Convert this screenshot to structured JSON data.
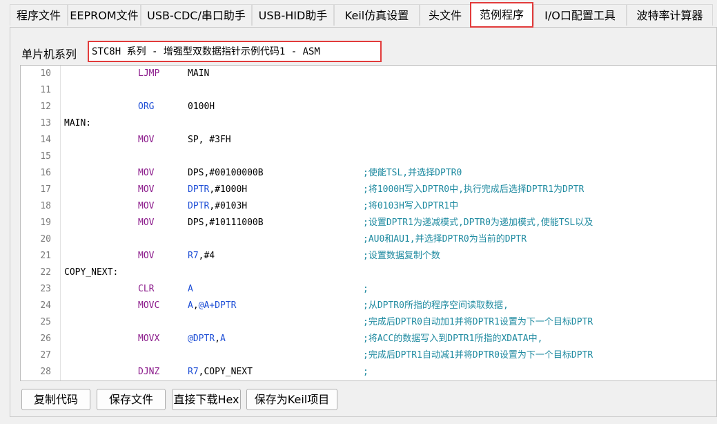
{
  "colors": {
    "highlight_border": "#e23b3b",
    "keyword_purple": "#8b1a8b",
    "register_blue": "#1f4fd6",
    "comment_teal": "#1e8aa0",
    "line_number_gray": "#7a7a7a"
  },
  "tabs": [
    {
      "label": "程序文件",
      "active": false
    },
    {
      "label": "EEPROM文件",
      "active": false
    },
    {
      "label": "USB-CDC/串口助手",
      "active": false
    },
    {
      "label": "USB-HID助手",
      "active": false
    },
    {
      "label": "Keil仿真设置",
      "active": false
    },
    {
      "label": "头文件",
      "active": false
    },
    {
      "label": "范例程序",
      "active": true
    },
    {
      "label": "I/O口配置工具",
      "active": false
    },
    {
      "label": "波特率计算器",
      "active": false
    }
  ],
  "series": {
    "label": "单片机系列",
    "selected": "STC8H 系列 - 增强型双数据指针示例代码1 - ASM"
  },
  "code_lines": [
    {
      "num": "10",
      "label": "",
      "mnemonic": "LJMP",
      "operand": "MAIN",
      "comment": ""
    },
    {
      "num": "11",
      "label": "",
      "mnemonic": "",
      "operand": "",
      "comment": ""
    },
    {
      "num": "12",
      "label": "",
      "mnemonic": "ORG",
      "operand": "0100H",
      "comment": ""
    },
    {
      "num": "13",
      "label": "MAIN:",
      "mnemonic": "",
      "operand": "",
      "comment": ""
    },
    {
      "num": "14",
      "label": "",
      "mnemonic": "MOV",
      "operand": "SP, #3FH",
      "comment": ""
    },
    {
      "num": "15",
      "label": "",
      "mnemonic": "",
      "operand": "",
      "comment": ""
    },
    {
      "num": "16",
      "label": "",
      "mnemonic": "MOV",
      "operand": "DPS,#00100000B",
      "comment": ";使能TSL,并选择DPTR0"
    },
    {
      "num": "17",
      "label": "",
      "mnemonic": "MOV",
      "operand": "DPTR,#1000H",
      "comment": ";将1000H写入DPTR0中,执行完成后选择DPTR1为DPTR"
    },
    {
      "num": "18",
      "label": "",
      "mnemonic": "MOV",
      "operand": "DPTR,#0103H",
      "comment": ";将0103H写入DPTR1中"
    },
    {
      "num": "19",
      "label": "",
      "mnemonic": "MOV",
      "operand": "DPS,#10111000B",
      "comment": ";设置DPTR1为递减模式,DPTR0为递加模式,使能TSL以及"
    },
    {
      "num": "20",
      "label": "",
      "mnemonic": "",
      "operand": "",
      "comment": ";AU0和AU1,并选择DPTR0为当前的DPTR"
    },
    {
      "num": "21",
      "label": "",
      "mnemonic": "MOV",
      "operand": "R7,#4",
      "comment": ";设置数据复制个数"
    },
    {
      "num": "22",
      "label": "COPY_NEXT:",
      "mnemonic": "",
      "operand": "",
      "comment": ""
    },
    {
      "num": "23",
      "label": "",
      "mnemonic": "CLR",
      "operand": "A",
      "comment": ";"
    },
    {
      "num": "24",
      "label": "",
      "mnemonic": "MOVC",
      "operand": "A,@A+DPTR",
      "comment": ";从DPTR0所指的程序空间读取数据,"
    },
    {
      "num": "25",
      "label": "",
      "mnemonic": "",
      "operand": "",
      "comment": ";完成后DPTR0自动加1并将DPTR1设置为下一个目标DPTR"
    },
    {
      "num": "26",
      "label": "",
      "mnemonic": "MOVX",
      "operand": "@DPTR,A",
      "comment": ";将ACC的数据写入到DPTR1所指的XDATA中,"
    },
    {
      "num": "27",
      "label": "",
      "mnemonic": "",
      "operand": "",
      "comment": ";完成后DPTR1自动减1并将DPTR0设置为下一个目标DPTR"
    },
    {
      "num": "28",
      "label": "",
      "mnemonic": "DJNZ",
      "operand": "R7,COPY_NEXT",
      "comment": ";"
    }
  ],
  "buttons": {
    "copy_code": "复制代码",
    "save_file": "保存文件",
    "download_hex": "直接下载Hex",
    "save_keil": "保存为Keil项目"
  }
}
